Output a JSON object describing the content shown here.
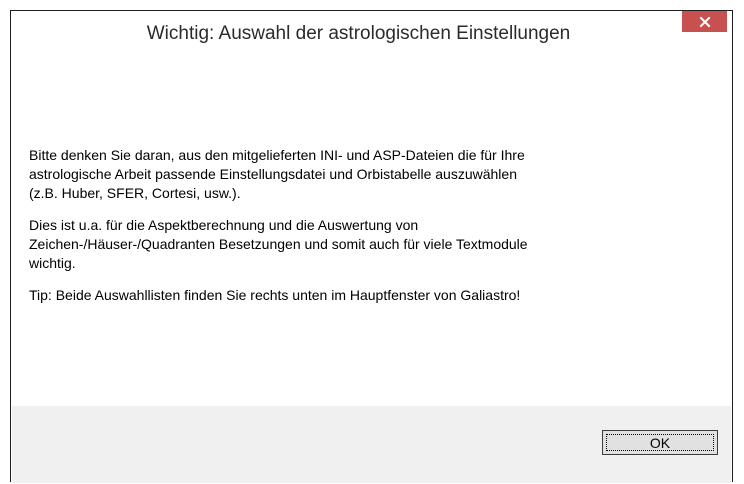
{
  "window": {
    "title": "Wichtig: Auswahl der astrologischen Einstellungen",
    "close_icon": "close-icon",
    "close_color": "#c75050"
  },
  "message": {
    "paragraphs": [
      "Bitte denken Sie daran, aus den mitgelieferten INI- und ASP-Dateien die für Ihre\nastrologische Arbeit passende Einstellungsdatei und Orbistabelle auszuwählen\n(z.B. Huber, SFER, Cortesi, usw.).",
      "Dies ist u.a. für die Aspektberechnung und die Auswertung von\nZeichen-/Häuser-/Quadranten Besetzungen und somit auch für viele Textmodule\nwichtig.",
      "Tip: Beide Auswahllisten finden Sie rechts unten im Hauptfenster von Galiastro!"
    ]
  },
  "footer": {
    "ok_label": "OK"
  }
}
